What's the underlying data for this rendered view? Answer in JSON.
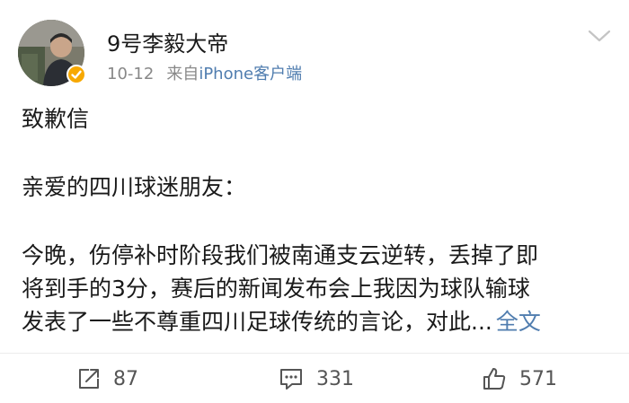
{
  "post": {
    "author": "9号李毅大帝",
    "date": "10-12",
    "source_prefix": "来自",
    "source": "iPhone客户端",
    "title": "致歉信",
    "salutation": "亲爱的四川球迷朋友：",
    "body_lines": [
      "今晚，伤停补时阶段我们被南通支云逆转，丢掉了即",
      "将到手的3分，赛后的新闻发布会上我因为球队输球",
      "发表了一些不尊重四川足球传统的言论，对此..."
    ],
    "more_label": "全文"
  },
  "actions": {
    "repost_count": "87",
    "comment_count": "331",
    "like_count": "571"
  },
  "icons": {
    "verified": "verified-badge-icon",
    "menu": "chevron-down-icon",
    "repost": "repost-icon",
    "comment": "comment-icon",
    "like": "thumbs-up-icon"
  },
  "colors": {
    "link": "#507daf",
    "meta": "#888888",
    "verified": "#f7a800"
  }
}
